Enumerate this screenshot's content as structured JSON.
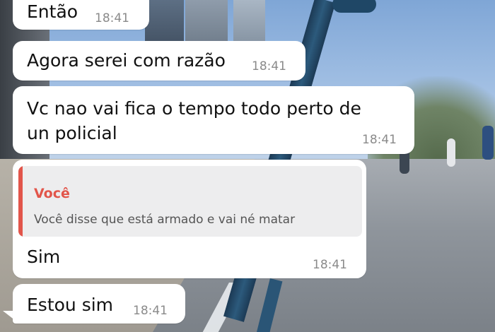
{
  "theme": {
    "quote_accent": "#e2554a",
    "bubble_background": "#ffffff",
    "timestamp_color": "#8a8a8a"
  },
  "chat": {
    "messages": [
      {
        "text": "Então",
        "time": "18:41"
      },
      {
        "text": "Agora serei com razão",
        "time": "18:41"
      },
      {
        "text_line1": "Vc nao vai fica o tempo todo perto de",
        "text_line2": "un policial",
        "time": "18:41"
      },
      {
        "quote_author": "Você",
        "quote_text": "Você disse que está armado e vai né matar",
        "text": "Sim",
        "time": "18:41"
      },
      {
        "text": "Estou sim",
        "time": "18:41"
      }
    ]
  }
}
